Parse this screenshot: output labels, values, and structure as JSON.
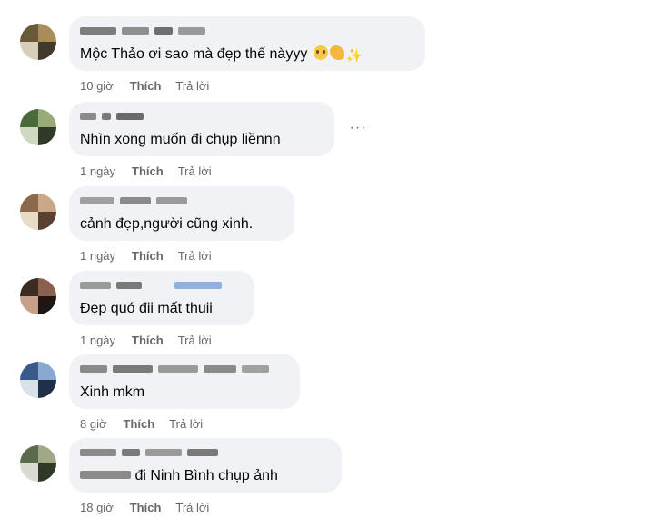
{
  "comments": [
    {
      "text": "Mộc Thảo ơi sao mà đẹp thế nàyyy",
      "emojis": [
        "pleading-face-icon",
        "flexed-biceps-icon",
        "sparkles-icon"
      ],
      "time": "10 giờ",
      "like": "Thích",
      "reply": "Trả lời",
      "avatar_colors": [
        "#6b5a3a",
        "#a88c5a",
        "#d8cfb8",
        "#3f3a2c"
      ]
    },
    {
      "text": "Nhìn xong muốn đi chụp liềnnn",
      "time": "1 ngày",
      "like": "Thích",
      "reply": "Trả lời",
      "more": "···",
      "avatar_colors": [
        "#4a6a3a",
        "#9aab7a",
        "#cfd8c0",
        "#2f3a28"
      ]
    },
    {
      "text": "cảnh đẹp,người cũng xinh.",
      "time": "1 ngày",
      "like": "Thích",
      "reply": "Trả lời",
      "avatar_colors": [
        "#8a6a4a",
        "#c8a888",
        "#e8dcc8",
        "#5a4030"
      ]
    },
    {
      "text": "Đẹp quó đii mất thuii",
      "time": "1 ngày",
      "like": "Thích",
      "reply": "Trả lời",
      "avatar_colors": [
        "#3a2a22",
        "#8a6050",
        "#c8a08a",
        "#1e1612"
      ]
    },
    {
      "text": "Xinh mkm",
      "time": "8 giờ",
      "like": "Thích",
      "reply": "Trả lời",
      "avatar_colors": [
        "#3a5a8a",
        "#8aa8d0",
        "#d8e0ea",
        "#203048"
      ]
    },
    {
      "text": "đi Ninh Bình chụp ảnh",
      "time": "18 giờ",
      "like": "Thích",
      "reply": "Trả lời",
      "avatar_colors": [
        "#5a6a4a",
        "#a0a888",
        "#d8dcd0",
        "#303828"
      ]
    }
  ]
}
